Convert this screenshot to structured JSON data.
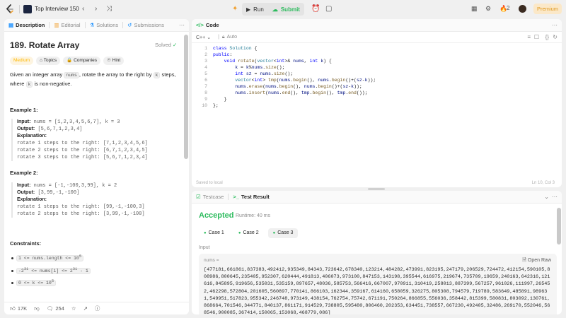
{
  "topbar": {
    "problem_list_title": "Top Interview 150",
    "run_label": "Run",
    "submit_label": "Submit",
    "streak_count": "2",
    "premium_label": "Premium"
  },
  "left_panel": {
    "tabs": [
      {
        "label": "Description",
        "icon": "description-icon"
      },
      {
        "label": "Editorial",
        "icon": "editorial-icon"
      },
      {
        "label": "Solutions",
        "icon": "solutions-icon"
      },
      {
        "label": "Submissions",
        "icon": "submissions-icon"
      }
    ],
    "title": "189. Rotate Array",
    "status": "Solved",
    "chips": [
      "Medium",
      "Topics",
      "Companies",
      "Hint"
    ],
    "description": {
      "p1": "Given an integer array ",
      "p1_code": "nums",
      "p2": ", rotate the array to the right by ",
      "p2_code": "k",
      "p3": " steps,",
      "p4": "where ",
      "p4_code": "k",
      "p5": " is non-negative."
    },
    "example1": {
      "heading": "Example 1:",
      "input_label": "Input:",
      "input": "nums = [1,2,3,4,5,6,7], k = 3",
      "output_label": "Output:",
      "output": "[5,6,7,1,2,3,4]",
      "explanation_label": "Explanation:",
      "lines": [
        "rotate 1 steps to the right: [7,1,2,3,4,5,6]",
        "rotate 2 steps to the right: [6,7,1,2,3,4,5]",
        "rotate 3 steps to the right: [5,6,7,1,2,3,4]"
      ]
    },
    "example2": {
      "heading": "Example 2:",
      "input_label": "Input:",
      "input": "nums = [-1,-100,3,99], k = 2",
      "output_label": "Output:",
      "output": "[3,99,-1,-100]",
      "explanation_label": "Explanation:",
      "lines": [
        "rotate 1 steps to the right: [99,-1,-100,3]",
        "rotate 2 steps to the right: [3,99,-1,-100]"
      ]
    },
    "constraints_heading": "Constraints:",
    "constraints": [
      {
        "pre": "1 <= nums.length <= 10",
        "sup": "5",
        "post": ""
      },
      {
        "pre": "-2",
        "sup": "31",
        "mid": " <= nums[i] <= 2",
        "sup2": "31",
        "post": " - 1"
      },
      {
        "pre": "0 <= k <= 10",
        "sup": "5",
        "post": ""
      }
    ],
    "footer": {
      "likes": "17K",
      "comments": "254"
    }
  },
  "code_panel": {
    "tab_label": "Code",
    "language": "C++",
    "mode": "Auto",
    "line_numbers": [
      "1",
      "2",
      "3",
      "4",
      "5",
      "6",
      "7",
      "8",
      "9",
      "10"
    ],
    "status_left": "Saved to local",
    "status_right": "Ln 10, Col 3"
  },
  "result_panel": {
    "tabs": [
      {
        "label": "Testcase"
      },
      {
        "label": "Test Result"
      }
    ],
    "verdict": "Accepted",
    "runtime": "Runtime: 40 ms",
    "cases": [
      "Case 1",
      "Case 2",
      "Case 3"
    ],
    "input_label": "Input",
    "var_label": "nums =",
    "open_raw": "Open Raw",
    "nums_value": "[477181,661861,837383,492412,935349,84343,723642,678340,123214,484282,473991,823195,247179,206529,724472,412154,590105,808986,800645,235405,952307,620444,491813,406073,973100,847153,143198,395544,616975,219674,735709,19659,240163,642316,121616,845895,919656,535031,535159,897657,48036,585753,566416,667007,970911,310419,258013,887399,567257,961026,111997,265452,462298,572804,201605,560897,770141,866103,162344,359167,614160,658059,326275,805308,794579,719789,583649,485891,989631,549951,517823,955342,246748,973149,438154,762754,75742,671191,750264,866855,556036,358442,815399,580831,803092,130761,868664,701546,344771,840137,861171,914529,738805,595480,806460,202353,634451,738557,667230,492405,32486,269170,552046,568546,900085,367414,150065,153068,468779,086]"
  }
}
